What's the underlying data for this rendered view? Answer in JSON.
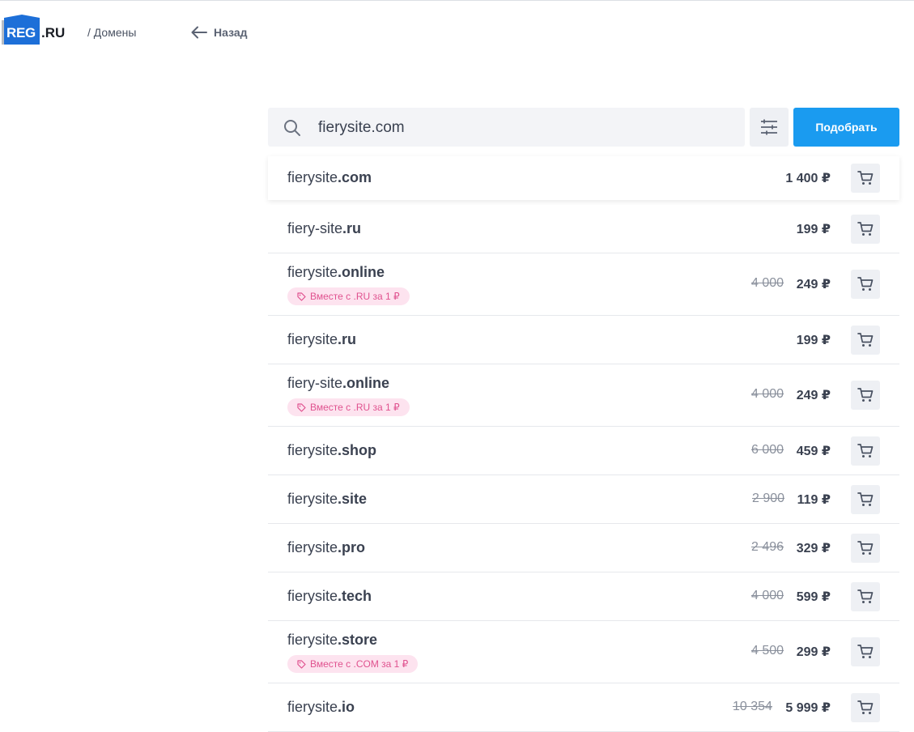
{
  "header": {
    "logo_reg": "REG",
    "logo_ru": ".RU",
    "breadcrumb": "/ Домены",
    "back_label": "Назад"
  },
  "search": {
    "value": "fierysite.com",
    "button_label": "Подобрать"
  },
  "domains": [
    {
      "name": "fierysite",
      "tld": ".com",
      "price": "1 400 ₽",
      "old_price": "",
      "badge": ""
    },
    {
      "name": "fiery-site",
      "tld": ".ru",
      "price": "199 ₽",
      "old_price": "",
      "badge": ""
    },
    {
      "name": "fierysite",
      "tld": ".online",
      "price": "249 ₽",
      "old_price": "4 000",
      "badge": "Вместе с .RU за 1 ₽"
    },
    {
      "name": "fierysite",
      "tld": ".ru",
      "price": "199 ₽",
      "old_price": "",
      "badge": ""
    },
    {
      "name": "fiery-site",
      "tld": ".online",
      "price": "249 ₽",
      "old_price": "4 000",
      "badge": "Вместе с .RU за 1 ₽"
    },
    {
      "name": "fierysite",
      "tld": ".shop",
      "price": "459 ₽",
      "old_price": "6 000",
      "badge": ""
    },
    {
      "name": "fierysite",
      "tld": ".site",
      "price": "119 ₽",
      "old_price": "2 900",
      "badge": ""
    },
    {
      "name": "fierysite",
      "tld": ".pro",
      "price": "329 ₽",
      "old_price": "2 496",
      "badge": ""
    },
    {
      "name": "fierysite",
      "tld": ".tech",
      "price": "599 ₽",
      "old_price": "4 000",
      "badge": ""
    },
    {
      "name": "fierysite",
      "tld": ".store",
      "price": "299 ₽",
      "old_price": "4 500",
      "badge": "Вместе с .COM за 1 ₽"
    },
    {
      "name": "fierysite",
      "tld": ".io",
      "price": "5 999 ₽",
      "old_price": "10 354",
      "badge": ""
    }
  ],
  "colors": {
    "accent": "#1a9bf0",
    "badge_bg": "#fde3ef",
    "badge_text": "#e0528f"
  }
}
